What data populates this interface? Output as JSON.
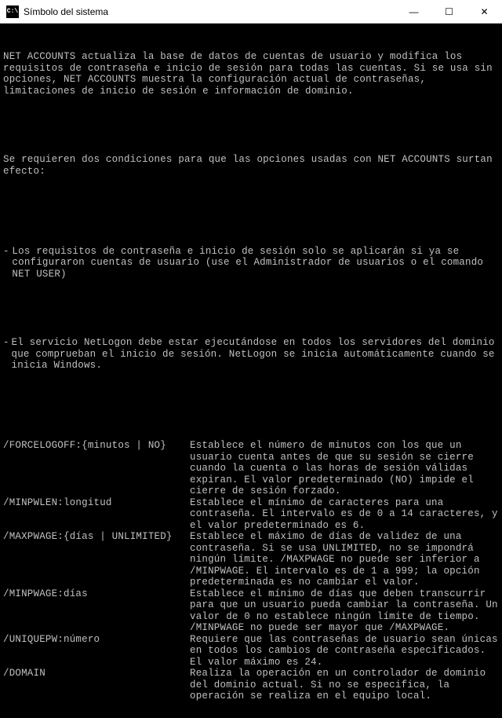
{
  "window": {
    "title": "Símbolo del sistema",
    "icon_label": "C:\\",
    "controls": {
      "minimize": "—",
      "maximize": "☐",
      "close": "✕"
    }
  },
  "intro": {
    "p1": "NET ACCOUNTS actualiza la base de datos de cuentas de usuario y modifica los requisitos de contraseña e inicio de sesión para todas las cuentas. Si se usa sin opciones, NET ACCOUNTS muestra la configuración actual de contraseñas, limitaciones de inicio de sesión e información de dominio.",
    "p2": "Se requieren dos condiciones para que las opciones usadas con NET ACCOUNTS surtan efecto:"
  },
  "bullets": {
    "b1_marker": "-  ",
    "b1": "Los requisitos de contraseña e inicio de sesión solo se aplicarán si ya se configuraron cuentas de usuario (use el Administrador de usuarios o el comando NET USER)",
    "b2_marker": "-  ",
    "b2": "El servicio NetLogon debe estar ejecutándose en todos los servidores del dominio que comprueban el inicio de sesión. NetLogon se inicia automáticamente cuando se inicia Windows."
  },
  "options": [
    {
      "name": "/FORCELOGOFF:{minutos | NO}",
      "desc": "Establece el número de minutos con los que un usuario cuenta antes de que su sesión se cierre cuando la cuenta o las horas de sesión válidas expiran. El valor predeterminado (NO) impide el cierre de sesión forzado."
    },
    {
      "name": "/MINPWLEN:longitud",
      "desc": "Establece el mínimo de caracteres para una contraseña. El intervalo es de 0 a 14 caracteres, y el valor predeterminado es 6."
    },
    {
      "name": "/MAXPWAGE:{días | UNLIMITED}",
      "desc": "Establece el máximo de días de validez de una contraseña. Si se usa UNLIMITED, no se impondrá ningún límite. /MAXPWAGE no puede ser inferior a /MINPWAGE. El intervalo es de 1 a 999; la opción predeterminada es no cambiar el valor."
    },
    {
      "name": "/MINPWAGE:días",
      "desc": "Establece el mínimo de días que deben transcurrir para que un usuario pueda cambiar la contraseña. Un valor de 0 no establece ningún límite de tiempo. /MINPWAGE no puede ser mayor que /MAXPWAGE."
    },
    {
      "name": "/UNIQUEPW:número",
      "desc": "Requiere que las contraseñas de usuario sean únicas en todos los cambios de contraseña especificados. El valor máximo es 24."
    },
    {
      "name": "/DOMAIN",
      "desc": "Realiza la operación en un controlador de dominio del dominio actual. Si no se especifica, la operación se realiza en el equipo local."
    }
  ]
}
